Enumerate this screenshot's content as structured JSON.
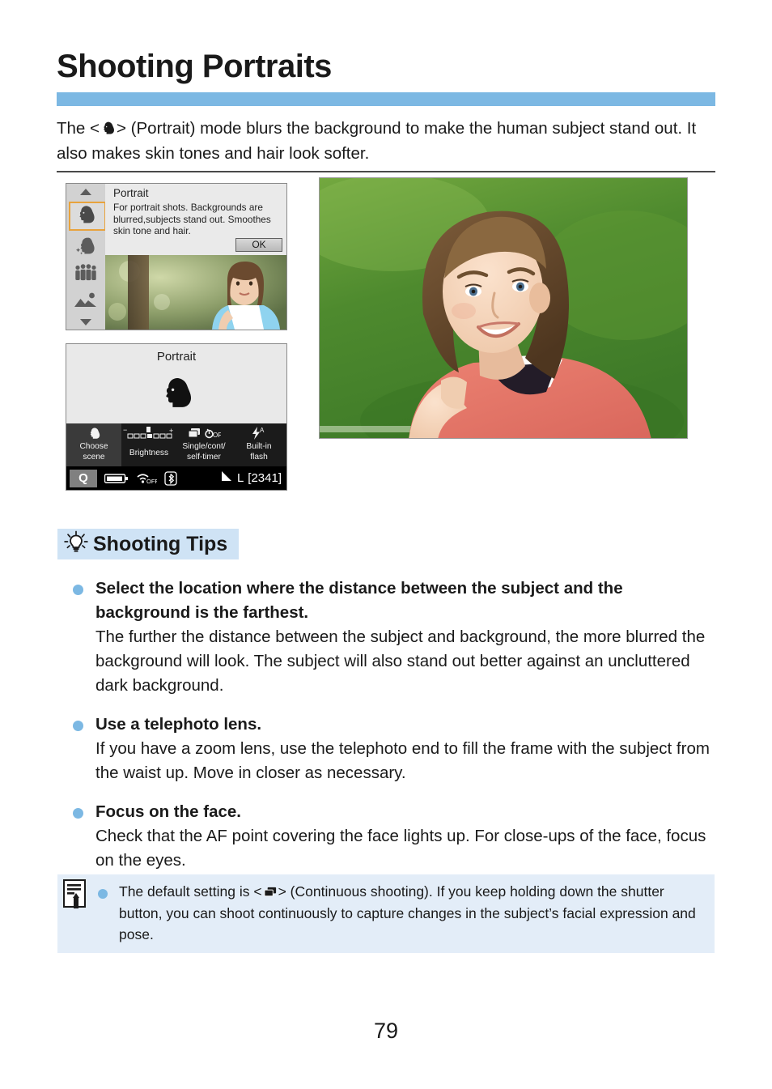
{
  "page": {
    "title": "Shooting Portraits",
    "number": "79",
    "accent_color": "#7cb8e3",
    "tips_header_bg": "#cfe3f5",
    "note_bg": "#e3edf8"
  },
  "intro": {
    "before_icon": "The <",
    "icon": "portrait-mode-icon",
    "after_icon": "> (Portrait) mode blurs the background to make the human subject stand out. It also makes skin tones and hair look softer."
  },
  "camera_screen_scene_select": {
    "name": "scene-select-screen",
    "sidebar_icons": [
      "scroll-up-arrow-icon",
      "portrait-scene-icon",
      "smooth-skin-scene-icon",
      "group-photo-scene-icon",
      "landscape-scene-icon",
      "scroll-down-arrow-icon"
    ],
    "selected_index": 1,
    "panel_title": "Portrait",
    "panel_description": "For portrait shots. Backgrounds are blurred,subjects stand out. Smoothes skin tone and hair.",
    "ok_button": "OK"
  },
  "camera_screen_quick_menu": {
    "name": "quick-control-screen",
    "mode_label": "Portrait",
    "mode_icon": "portrait-mode-icon",
    "quick_items": [
      {
        "icon": "portrait-mode-icon",
        "label": "Choose\nscene",
        "label_line1": "Choose",
        "label_line2": "scene",
        "active": true
      },
      {
        "icon": "brightness-scale-icon",
        "label_line1": "Brightness",
        "label_line2": "",
        "active": false
      },
      {
        "icon": "drive-mode-icon",
        "label_line1": "Single/cont/",
        "label_line2": "self-timer",
        "active": false
      },
      {
        "icon": "flash-auto-icon",
        "label_line1": "Built-in",
        "label_line2": "flash",
        "active": false
      }
    ],
    "status_bar": {
      "q_badge": "Q",
      "battery_icon": "battery-icon",
      "wifi_icon": "wifi-off-icon",
      "bluetooth_icon": "bluetooth-icon",
      "image_quality": "L",
      "shots_remaining": "[2341]"
    }
  },
  "sample_photo": {
    "name": "portrait-sample-photo",
    "alt": "Smiling woman with blurred green background"
  },
  "tips_section": {
    "icon": "lightbulb-icon",
    "heading": "Shooting Tips",
    "tips": [
      {
        "title": "Select the location where the distance between the subject and the background is the farthest.",
        "body": "The further the distance between the subject and background, the more blurred the background will look. The subject will also stand out better against an uncluttered dark background."
      },
      {
        "title": "Use a telephoto lens.",
        "body": "If you have a zoom lens, use the telephoto end to fill the frame with the subject from the waist up. Move in closer as necessary."
      },
      {
        "title": "Focus on the face.",
        "body": "Check that the AF point covering the face lights up. For close-ups of the face, focus on the eyes."
      }
    ]
  },
  "note": {
    "icon": "memo-note-icon",
    "before_icon": "The default setting is <",
    "inline_icon": "continuous-shooting-icon",
    "after_icon": "> (Continuous shooting). If you keep holding down the shutter button, you can shoot continuously to capture changes in the subject’s facial expression and pose."
  }
}
